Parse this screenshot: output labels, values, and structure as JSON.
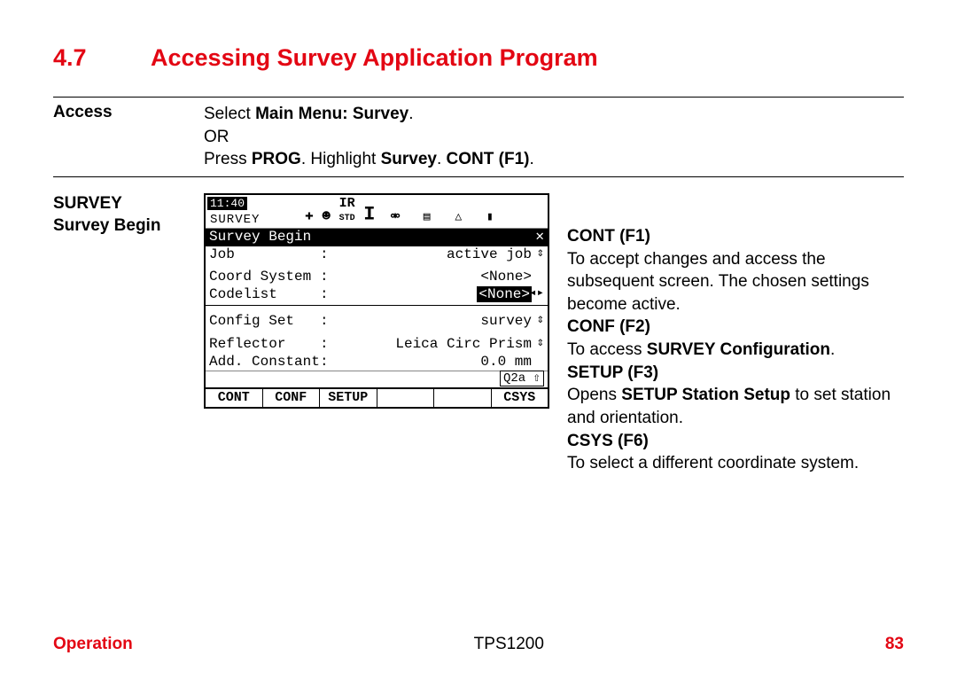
{
  "heading": {
    "num": "4.7",
    "title": "Accessing Survey Application Program"
  },
  "access": {
    "label": "Access",
    "line1_pre": "Select ",
    "line1_b": "Main Menu: Survey",
    "line1_post": ".",
    "or": "OR",
    "line2_pre": "Press ",
    "line2_b1": "PROG",
    "line2_mid": ". Highlight ",
    "line2_b2": "Survey",
    "line2_mid2": ". ",
    "line2_b3": "CONT (F1)",
    "line2_post": "."
  },
  "survey_label": {
    "l1": "SURVEY",
    "l2": "Survey Begin"
  },
  "lcd": {
    "time": "11:40",
    "mode": "SURVEY",
    "ir": "IR",
    "std": "STD",
    "i": "I",
    "title": "Survey Begin",
    "close": "✕",
    "rows": {
      "job_l": "Job",
      "job_v": "active job",
      "cs_l": "Coord System",
      "cs_v": "<None>",
      "cl_l": "Codelist",
      "cl_v": "<None>",
      "cfg_l": "Config Set",
      "cfg_v": "survey",
      "ref_l": "Reflector",
      "ref_v": "Leica Circ Prism",
      "add_l": "Add. Constant",
      "add_v": "0.0 mm"
    },
    "status": "Q2a ⇧",
    "soft": {
      "f1": "CONT",
      "f2": "CONF",
      "f3": "SETUP",
      "f4": "",
      "f5": "",
      "f6": "CSYS"
    }
  },
  "desc": {
    "d1t": "CONT (F1)",
    "d1b": "To accept changes and access the subsequent screen. The chosen settings become active.",
    "d2t": "CONF (F2)",
    "d2b_pre": "To access ",
    "d2b_b": "SURVEY Configuration",
    "d2b_post": ".",
    "d3t": "SETUP (F3)",
    "d3b_pre": "Opens ",
    "d3b_b": "SETUP Station Setup",
    "d3b_post": " to set station and orientation.",
    "d4t": "CSYS (F6)",
    "d4b": "To select a different coordinate system."
  },
  "footer": {
    "left": "Operation",
    "center": "TPS1200",
    "right": "83"
  }
}
